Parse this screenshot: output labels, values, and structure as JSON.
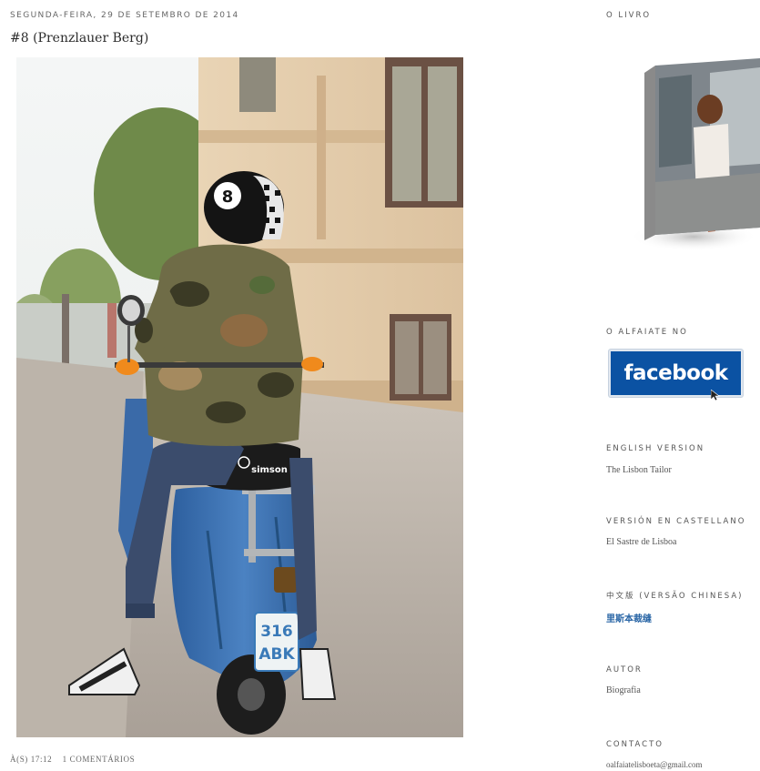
{
  "post": {
    "date": "SEGUNDA-FEIRA, 29 DE SETEMBRO DE 2014",
    "title": "#8 (Prenzlauer Berg)",
    "footer_time": "À(S) 17:12",
    "footer_comments": "1 COMENTÁRIOS",
    "photo": {
      "plate_line1": "316",
      "plate_line2": "ABK",
      "seat_brand": "simson"
    }
  },
  "sidebar": {
    "book_title": "O LIVRO",
    "facebook_title": "O ALFAIATE NO",
    "facebook_logo_text": "facebook",
    "english_title": "ENGLISH VERSION",
    "english_link": "The Lisbon Tailor",
    "castellano_title": "VERSIÓN EN CASTELLANO",
    "castellano_link": "El Sastre de Lisboa",
    "chinese_title": "中文版 (VERSÃO CHINESA)",
    "chinese_link": "里斯本裁缝",
    "author_title": "AUTOR",
    "author_link": "Biografia",
    "contact_title": "CONTACTO",
    "contact_link": "oalfaiatelisboeta@gmail.com"
  },
  "colors": {
    "facebook_blue": "#0b52a3",
    "scooter_blue": "#3a6fb0",
    "building": "#e6cfae"
  }
}
